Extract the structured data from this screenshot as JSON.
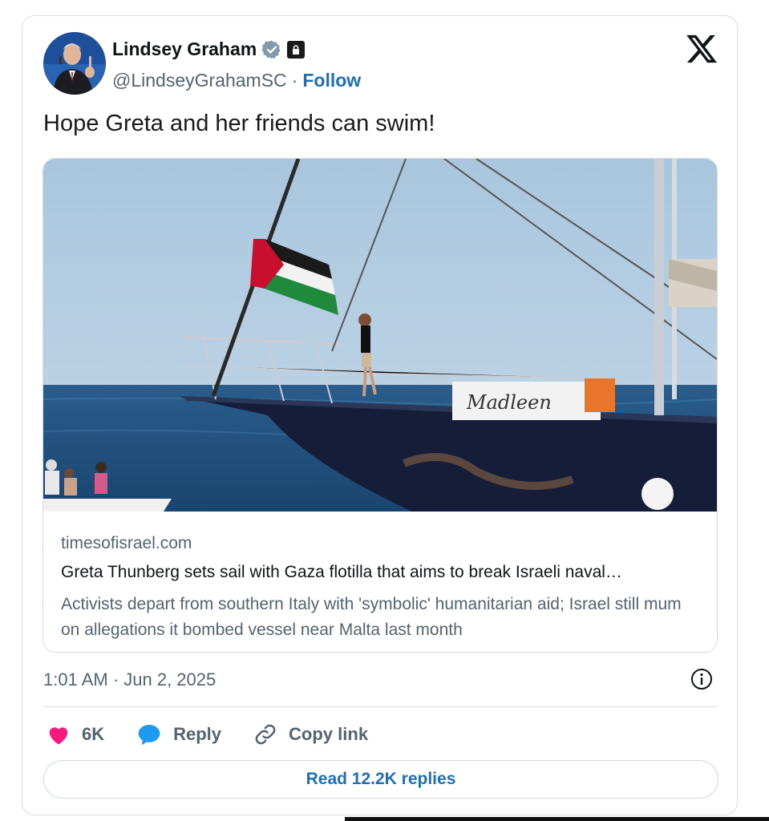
{
  "author": {
    "name": "Lindsey Graham",
    "handle": "@LindseyGrahamSC",
    "separator": "·",
    "follow_label": "Follow"
  },
  "tweet": {
    "text": "Hope Greta and her friends can swim!"
  },
  "link_card": {
    "domain": "timesofisrael.com",
    "title": "Greta Thunberg sets sail with Gaza flotilla that aims to break Israeli naval…",
    "description": "Activists depart from southern Italy with 'symbolic' humanitarian aid; Israel still mum on allegations it bombed vessel near Malta last month",
    "boat_name": "Madleen"
  },
  "meta": {
    "timestamp": "1:01 AM · Jun 2, 2025"
  },
  "actions": {
    "likes": "6K",
    "reply_label": "Reply",
    "copy_label": "Copy link"
  },
  "read_replies_label": "Read 12.2K replies",
  "icons": [
    "verified-badge-icon",
    "lock-icon",
    "x-logo-icon",
    "info-icon",
    "heart-icon",
    "reply-bubble-icon",
    "link-icon"
  ],
  "colors": {
    "accent": "#1d6fb8",
    "like": "#f91880",
    "reply": "#1d9bf0",
    "muted": "#536471"
  }
}
